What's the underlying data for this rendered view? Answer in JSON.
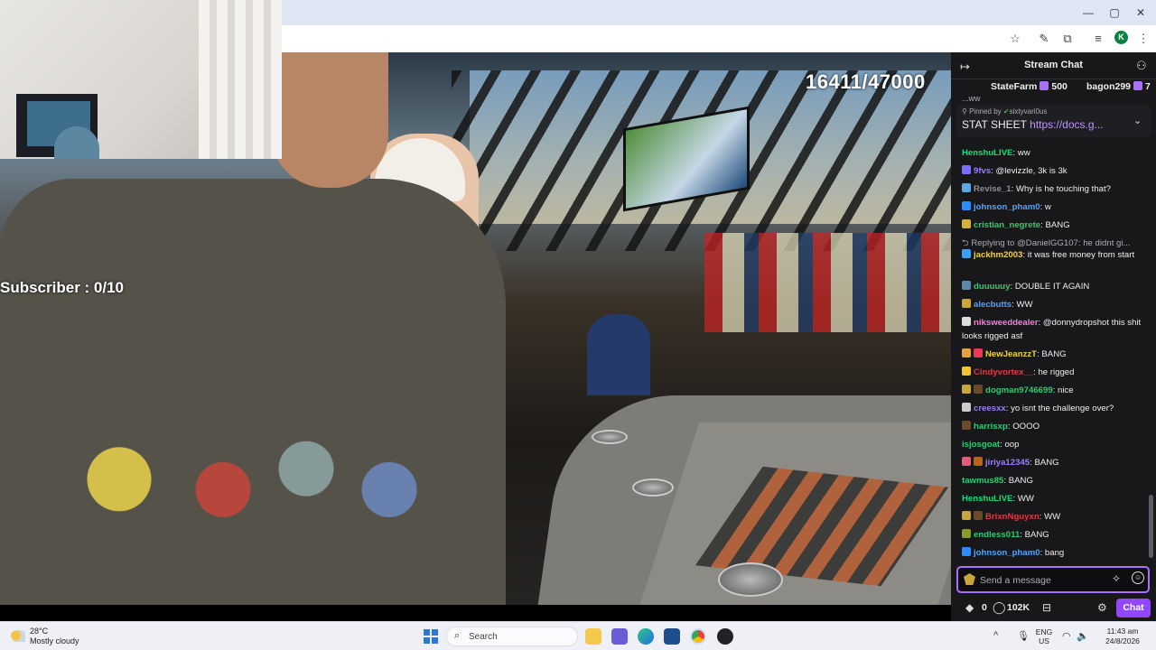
{
  "browser": {
    "window_controls": [
      "—",
      "▢",
      "✕"
    ],
    "profile_initial": "K"
  },
  "stream": {
    "counter": "16411/47000",
    "subscriber_goal": "Subscriber : 0/10"
  },
  "chat": {
    "title": "Stream Chat",
    "leaderboard": [
      {
        "name": "StateFarm",
        "value": "500"
      },
      {
        "name": "bagon299",
        "value": "7"
      }
    ],
    "pinned": {
      "label": "Pinned by",
      "author": "sixtyvari0us",
      "text": "STAT SHEET",
      "link": "https://docs.g..."
    },
    "partial_top": "...ww",
    "messages": [
      {
        "user": "HenshuLIVE",
        "color": "#00e676",
        "text": "ww",
        "badges": []
      },
      {
        "user": "9fvs",
        "color": "#9b7dff",
        "text": "@levizzle, 3k is 3k",
        "badges": [
          "#7a6cff"
        ]
      },
      {
        "user": "Revise_1",
        "color": "#8e8e99",
        "text": "Why is he touching that?",
        "badges": [
          "#5aa9e6"
        ]
      },
      {
        "user": "johnson_pham0",
        "color": "#4fa3ff",
        "text": "w",
        "badges": [
          "#2e8bff"
        ]
      },
      {
        "user": "cristian_negrete",
        "color": "#2ecc71",
        "text": "BANG",
        "badges": [
          "#d4b13a"
        ]
      },
      {
        "user": "",
        "color": "#adadb8",
        "text": "Replying to @DanielGG107: he didnt gi...",
        "badges": [],
        "reply": true
      },
      {
        "user": "jackhm2003",
        "color": "#f4d03f",
        "text": "it was free money from start",
        "badges": [
          "#3aa0ff"
        ]
      },
      {
        "user": "duuuuuy",
        "color": "#2ecc71",
        "text": "DOUBLE IT AGAIN",
        "badges": [
          "#5c8aa8"
        ]
      },
      {
        "user": "alecbutts",
        "color": "#4fa3ff",
        "text": "WW",
        "badges": [
          "#c9a53b"
        ]
      },
      {
        "user": "niksweeddealer",
        "color": "#ff7ad9",
        "text": "@donnydropshot this shit looks rigged asf",
        "badges": [
          "#dddddd"
        ]
      },
      {
        "user": "NewJeanzzT",
        "color": "#f4d03f",
        "text": "BANG",
        "badges": [
          "#e8a23b",
          "#e83b5a"
        ]
      },
      {
        "user": "Cindyvortex__",
        "color": "#e33b3b",
        "text": "he rigged",
        "badges": [
          "#f4c430"
        ]
      },
      {
        "user": "dogman9746699",
        "color": "#2ecc71",
        "text": "nice",
        "badges": [
          "#c9a53b",
          "#6b4a2b"
        ]
      },
      {
        "user": "creesxx",
        "color": "#9b7dff",
        "text": "yo isnt the challenge over?",
        "badges": [
          "#cccccc"
        ]
      },
      {
        "user": "harrisxp",
        "color": "#2ecc71",
        "text": "OOOO",
        "badges": [
          "#6b4a2b"
        ]
      },
      {
        "user": "isjosgoat",
        "color": "#2ecc71",
        "text": "oop",
        "badges": []
      },
      {
        "user": "jiriya12345",
        "color": "#9b7dff",
        "text": "BANG",
        "badges": [
          "#e85a7a",
          "#b5651d"
        ]
      },
      {
        "user": "tawmus85",
        "color": "#2ecc71",
        "text": "BANG",
        "badges": []
      },
      {
        "user": "HenshuLIVE",
        "color": "#00e676",
        "text": "WW",
        "badges": []
      },
      {
        "user": "BrixnNguyxn",
        "color": "#e33b3b",
        "text": "WW",
        "badges": [
          "#c9a53b",
          "#6b4a2b"
        ]
      },
      {
        "user": "endless011",
        "color": "#2ecc71",
        "text": "BANG",
        "badges": [
          "#8a9a2b"
        ]
      },
      {
        "user": "johnson_pham0",
        "color": "#4fa3ff",
        "text": "bang",
        "badges": [
          "#2e8bff"
        ]
      }
    ],
    "input_placeholder": "Send a message",
    "points": "0",
    "viewers": "102K",
    "chat_button": "Chat"
  },
  "taskbar": {
    "weather_temp": "28°C",
    "weather_desc": "Mostly cloudy",
    "search_label": "Search",
    "lang": "ENG",
    "region": "US",
    "time": "11:43 am",
    "date": "24/8/2026"
  }
}
